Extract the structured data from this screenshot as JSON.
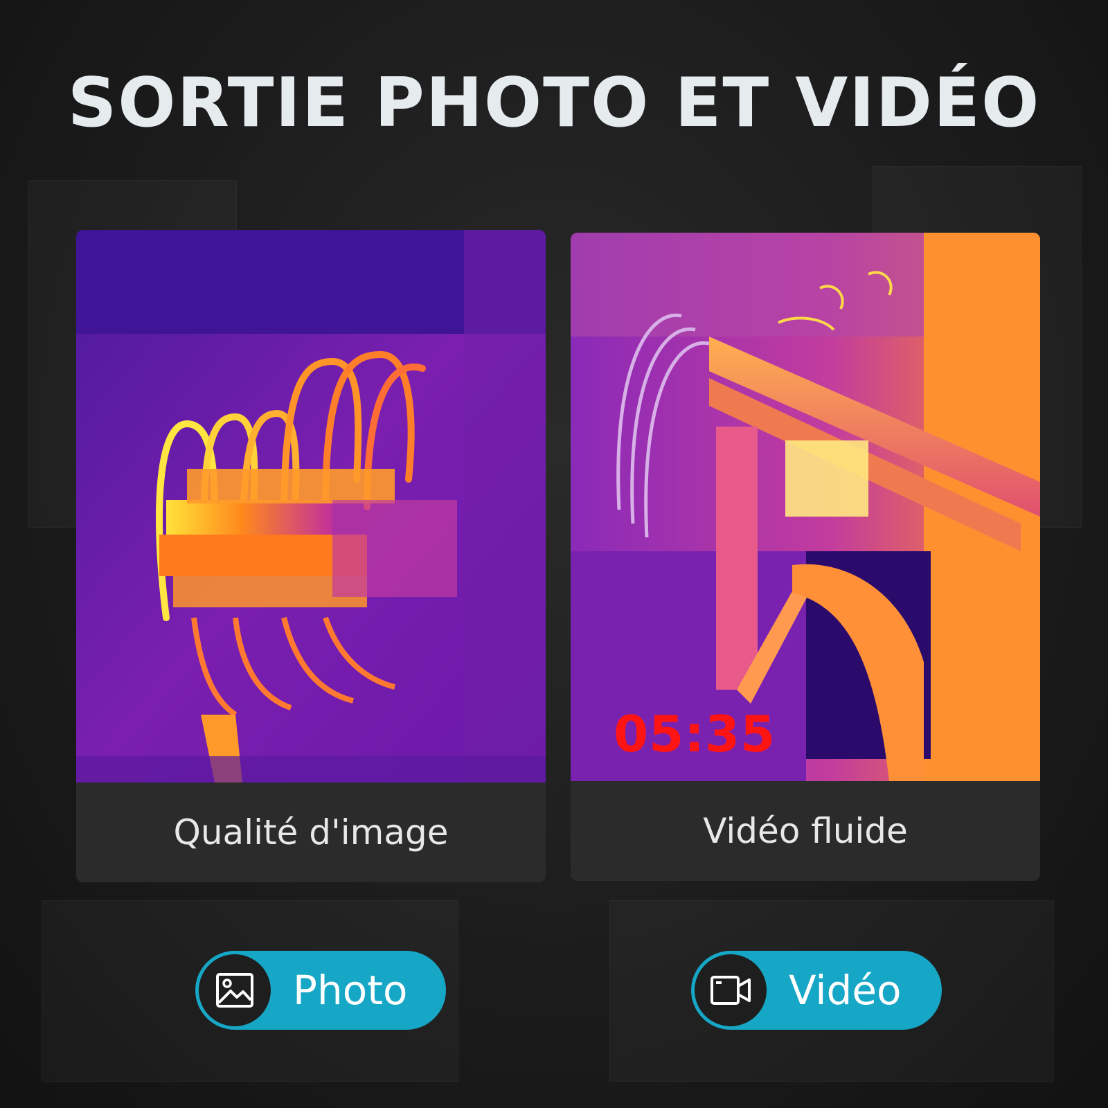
{
  "title": "SORTIE PHOTO ET VIDÉO",
  "cards": [
    {
      "caption": "Qualité d'image"
    },
    {
      "caption": "Vidéo fluide",
      "timer": "05:35"
    }
  ],
  "buttons": [
    {
      "label": "Photo",
      "icon": "image-icon"
    },
    {
      "label": "Vidéo",
      "icon": "video-camera-icon"
    }
  ],
  "colors": {
    "accent": "#17a7c6",
    "timer": "#ff1414",
    "card_bg": "#2b2b2b"
  }
}
